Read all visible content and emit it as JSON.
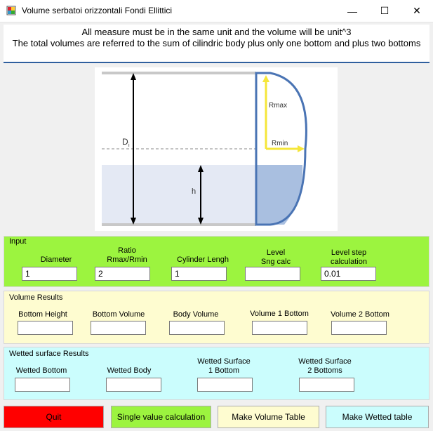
{
  "window": {
    "title": "Volume serbatoi orizzontali Fondi Ellittici",
    "minimize_glyph": "—",
    "maximize_glyph": "☐",
    "close_glyph": "✕"
  },
  "header": {
    "line1": "All measure must be in the same unit and the volume will be unit^3",
    "line2": "The total volumes are referred to the sum of cilindric body plus only one bottom  and plus two bottoms"
  },
  "diagram": {
    "label_di": "D",
    "label_di_sub": "i",
    "label_h": "h",
    "label_rmax": "Rmax",
    "label_rmin": "Rmin"
  },
  "input": {
    "title": "Input",
    "diameter_label": "Diameter",
    "diameter_value": "1",
    "ratio_label_1": "Ratio",
    "ratio_label_2": "Rmax/Rmin",
    "ratio_value": "2",
    "cylinder_label": "Cylinder Lengh",
    "cylinder_value": "1",
    "level_label_1": "Level",
    "level_label_2": "Sng calc",
    "level_value": "",
    "step_label_1": "Level step",
    "step_label_2": "calculation",
    "step_value": "0.01"
  },
  "volume_results": {
    "title": "Volume Results",
    "bottom_height_label": "Bottom Height",
    "bottom_volume_label": "Bottom Volume",
    "body_volume_label": "Body Volume",
    "volume1_label": "Volume 1 Bottom",
    "volume2_label": "Volume 2 Bottom",
    "bottom_height_value": "",
    "bottom_volume_value": "",
    "body_volume_value": "",
    "volume1_value": "",
    "volume2_value": ""
  },
  "wetted_results": {
    "title": "Wetted surface Results",
    "wetted_bottom_label": "Wetted Bottom",
    "wetted_body_label": "Wetted Body",
    "ws1_label_1": "Wetted Surface",
    "ws1_label_2": "1 Bottom",
    "ws2_label_1": "Wetted Surface",
    "ws2_label_2": "2 Bottoms",
    "wetted_bottom_value": "",
    "wetted_body_value": "",
    "ws1_value": "",
    "ws2_value": ""
  },
  "buttons": {
    "quit": "Quit",
    "single": "Single value calculation",
    "volume_table": "Make Volume Table",
    "wetted_table": "Make Wetted table"
  },
  "colors": {
    "input_bg": "#9cf43f",
    "volume_bg": "#fefcd0",
    "wetted_bg": "#cbfdfd",
    "quit_bg": "#ff0000",
    "single_bg": "#9cf43f",
    "volume_table_bg": "#fefcd0",
    "wetted_table_bg": "#cbfdfd",
    "diagram_blue": "#4a74b4",
    "arrow_yellow": "#f5e63a"
  }
}
